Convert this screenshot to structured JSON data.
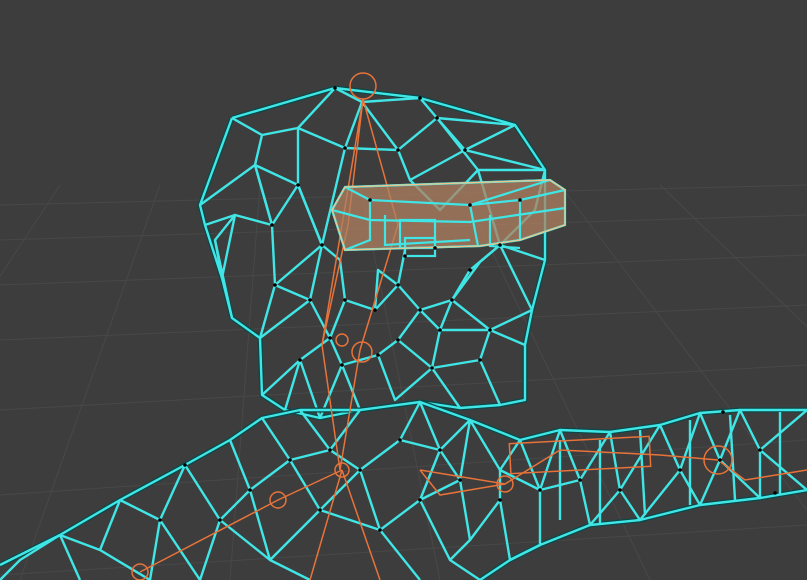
{
  "viewport": {
    "mode": "wireframe",
    "selected_object": "visor",
    "colors": {
      "background": "#3d3d3d",
      "grid": "#4a4a4a",
      "wire": "#40e6e6",
      "wire_dark": "#0b4848",
      "armature": "#e8733a",
      "selection": "#f2c48a",
      "selection_fill": "#b08060",
      "vertex": "#000000"
    }
  }
}
